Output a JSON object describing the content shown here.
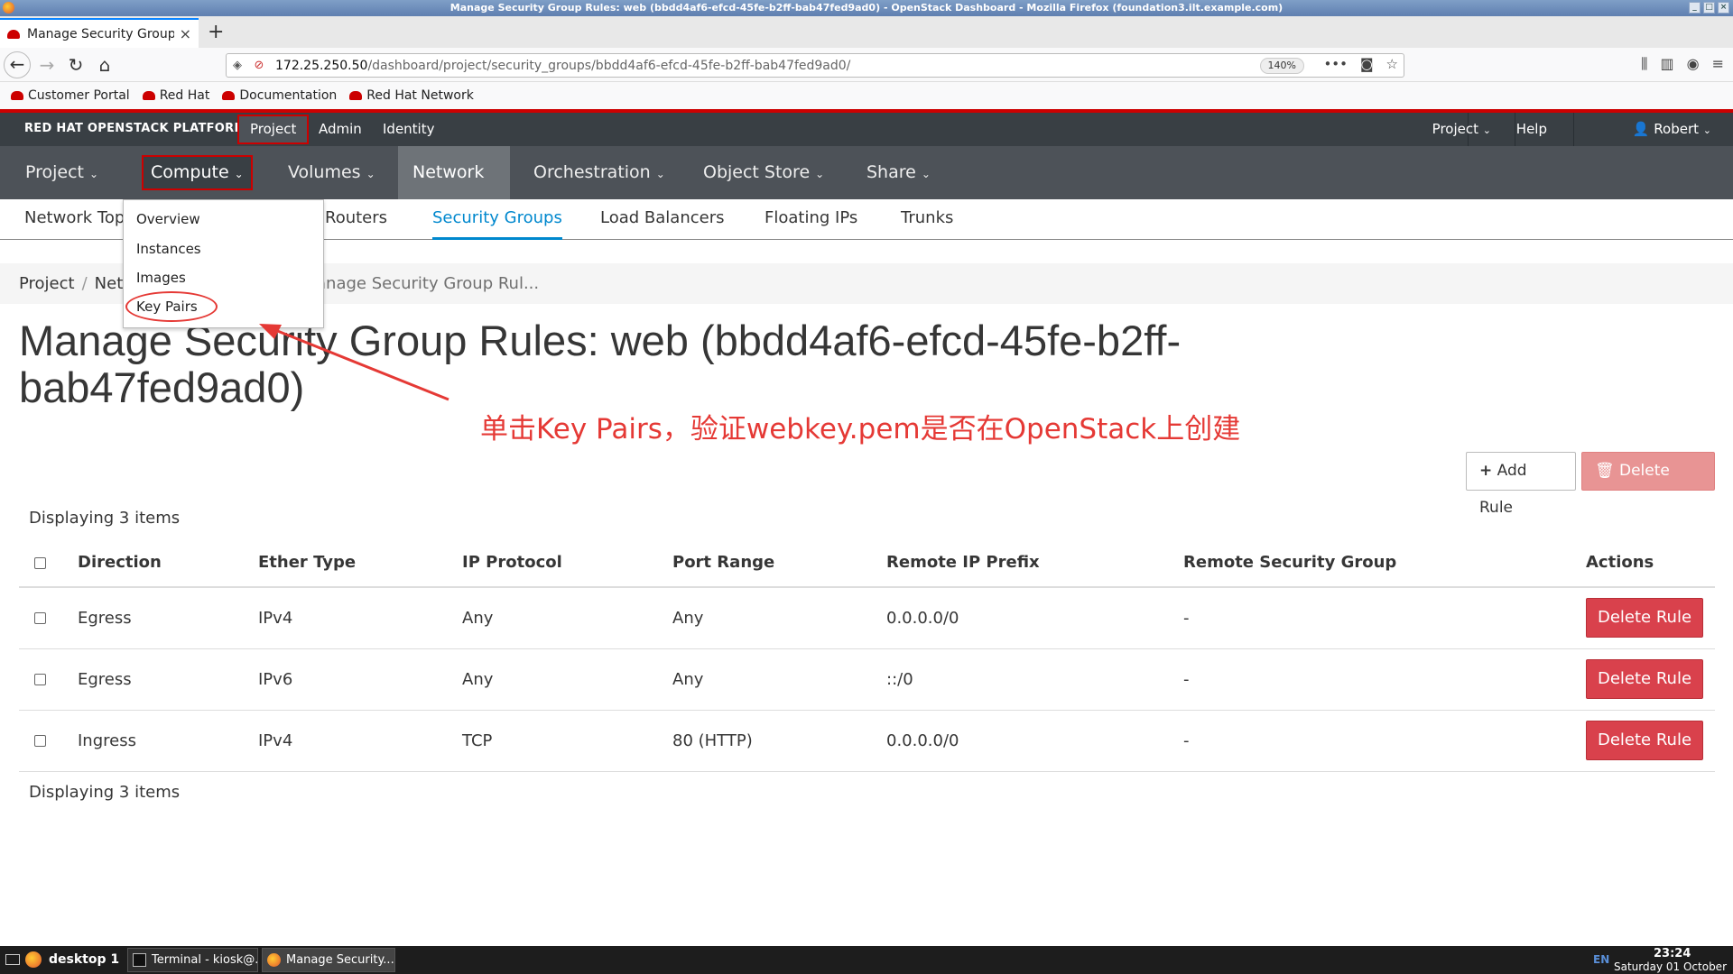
{
  "window": {
    "title": "Manage Security Group Rules: web (bbdd4af6-efcd-45fe-b2ff-bab47fed9ad0) - OpenStack Dashboard - Mozilla Firefox (foundation3.ilt.example.com)"
  },
  "browser": {
    "tab_title": "Manage Security Group",
    "new_tab": "+",
    "url_host": "172.25.250.50",
    "url_path": "/dashboard/project/security_groups/bbdd4af6-efcd-45fe-b2ff-bab47fed9ad0/",
    "zoom": "140%",
    "bookmarks": [
      "Customer Portal",
      "Red Hat",
      "Documentation",
      "Red Hat Network"
    ]
  },
  "masthead": {
    "brand": "RED HAT OPENSTACK PLATFORM",
    "tabs": [
      "Project",
      "Admin",
      "Identity"
    ],
    "right_project": "Project",
    "help": "Help",
    "user": "Robert"
  },
  "primary_nav": {
    "items": [
      "Project",
      "Compute",
      "Volumes",
      "Network",
      "Orchestration",
      "Object Store",
      "Share"
    ],
    "active": "Network",
    "highlighted": "Compute"
  },
  "secondary_nav": {
    "items": [
      "Network Topo",
      "Routers",
      "Security Groups",
      "Load Balancers",
      "Floating IPs",
      "Trunks"
    ],
    "active": "Security Groups"
  },
  "compute_menu": {
    "items": [
      "Overview",
      "Instances",
      "Images",
      "Key Pairs"
    ],
    "highlighted": "Key Pairs"
  },
  "breadcrumb": {
    "items": [
      "Project",
      "Netw"
    ],
    "current": "anage Security Group Rul..."
  },
  "page": {
    "title": "Manage Security Group Rules: web (bbdd4af6-efcd-45fe-b2ff-bab47fed9ad0)",
    "add_rule": "Add Rule",
    "delete_rules": "Delete Rules",
    "display_count": "Displaying 3 items"
  },
  "annotation": {
    "text": "单击Key Pairs，验证webkey.pem是否在OpenStack上创建",
    "color": "#e53935"
  },
  "table": {
    "headers": [
      "Direction",
      "Ether Type",
      "IP Protocol",
      "Port Range",
      "Remote IP Prefix",
      "Remote Security Group",
      "Actions"
    ],
    "rows": [
      {
        "direction": "Egress",
        "ether_type": "IPv4",
        "ip_protocol": "Any",
        "port_range": "Any",
        "remote_ip_prefix": "0.0.0.0/0",
        "remote_sg": "-",
        "action": "Delete Rule"
      },
      {
        "direction": "Egress",
        "ether_type": "IPv6",
        "ip_protocol": "Any",
        "port_range": "Any",
        "remote_ip_prefix": "::/0",
        "remote_sg": "-",
        "action": "Delete Rule"
      },
      {
        "direction": "Ingress",
        "ether_type": "IPv4",
        "ip_protocol": "TCP",
        "port_range": "80 (HTTP)",
        "remote_ip_prefix": "0.0.0.0/0",
        "remote_sg": "-",
        "action": "Delete Rule"
      }
    ]
  },
  "taskbar": {
    "workspace": "desktop 1",
    "tasks": [
      "Terminal - kiosk@...",
      "Manage Security..."
    ],
    "lang": "EN",
    "time": "23:24",
    "date": "Saturday 01 October"
  },
  "colors": {
    "accent": "#0088ce",
    "brand_red": "#cc0000",
    "danger": "#d9414c"
  }
}
